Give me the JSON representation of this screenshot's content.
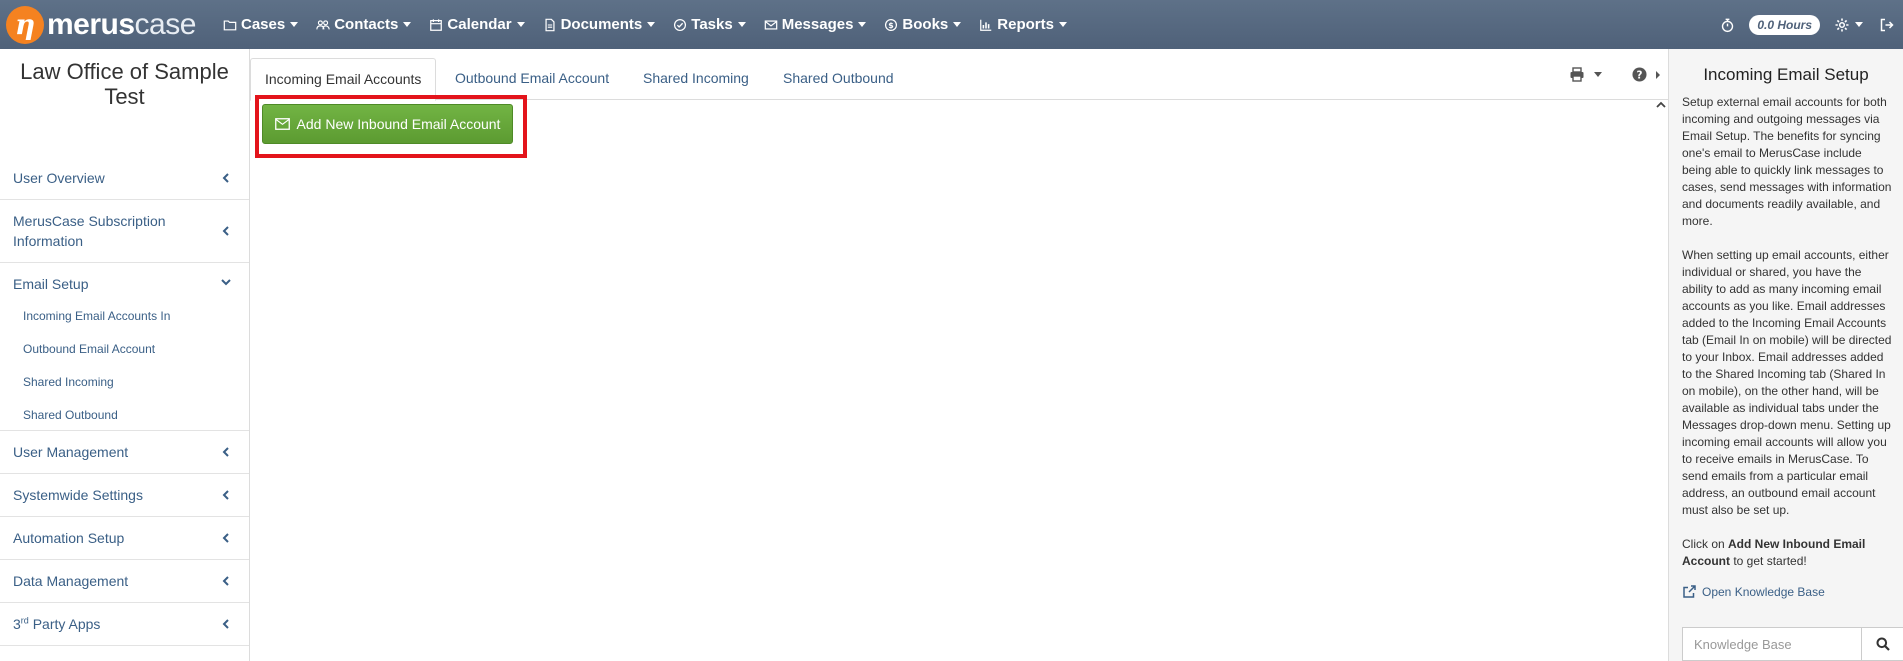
{
  "brand": {
    "mark": "η",
    "name_bold": "merus",
    "name_light": "case"
  },
  "nav": {
    "items": [
      {
        "label": "Cases",
        "icon": "folder-icon"
      },
      {
        "label": "Contacts",
        "icon": "users-icon"
      },
      {
        "label": "Calendar",
        "icon": "calendar-icon"
      },
      {
        "label": "Documents",
        "icon": "document-icon"
      },
      {
        "label": "Tasks",
        "icon": "check-circle-icon"
      },
      {
        "label": "Messages",
        "icon": "envelope-icon"
      },
      {
        "label": "Books",
        "icon": "dollar-circle-icon"
      },
      {
        "label": "Reports",
        "icon": "bar-chart-icon"
      }
    ],
    "hours": "0.0 Hours"
  },
  "sidebar": {
    "office_title": "Law Office of Sample Test",
    "groups": [
      {
        "label": "User Overview",
        "expanded": false
      },
      {
        "label": "MerusCase Subscription Information",
        "expanded": false
      },
      {
        "label": "Email Setup",
        "expanded": true,
        "items": [
          "Incoming Email Accounts In",
          "Outbound Email Account",
          "Shared Incoming",
          "Shared Outbound"
        ]
      },
      {
        "label": "User Management",
        "expanded": false
      },
      {
        "label": "Systemwide Settings",
        "expanded": false
      },
      {
        "label": "Automation Setup",
        "expanded": false
      },
      {
        "label": "Data Management",
        "expanded": false
      },
      {
        "label_pre": "3",
        "label_sup": "rd",
        "label_post": " Party Apps",
        "expanded": false
      }
    ]
  },
  "tabs": [
    {
      "label": "Incoming Email Accounts",
      "active": true
    },
    {
      "label": "Outbound Email Account",
      "active": false
    },
    {
      "label": "Shared Incoming",
      "active": false
    },
    {
      "label": "Shared Outbound",
      "active": false
    }
  ],
  "main": {
    "add_button_label": "Add New Inbound Email Account"
  },
  "help": {
    "title": "Incoming Email Setup",
    "para1": "Setup external email accounts for both incoming and outgoing messages via Email Setup. The benefits for syncing one's email to MerusCase include being able to quickly link messages to cases, send messages with information and documents readily available, and more.",
    "para2": "When setting up email accounts, either individual or shared, you have the ability to add as many incoming email accounts as you like. Email addresses added to the Incoming Email Accounts tab (Email In on mobile) will be directed to your Inbox. Email addresses added to the Shared Incoming tab (Shared In on mobile), on the other hand, will be available as individual tabs under the Messages drop-down menu. Setting up incoming email accounts will allow you to receive emails in MerusCase. To send emails from a particular email address, an outbound email account must also be set up.",
    "para3_pre": "Click on ",
    "para3_bold": "Add New Inbound Email Account",
    "para3_post": " to get started!",
    "kb_link": "Open Knowledge Base",
    "search_placeholder": "Knowledge Base"
  },
  "colors": {
    "navbar": "#5e7188",
    "brand_orange": "#f58220",
    "button_green": "#6aab3d",
    "highlight_red": "#e3141b",
    "link_blue": "#3a5f86"
  }
}
